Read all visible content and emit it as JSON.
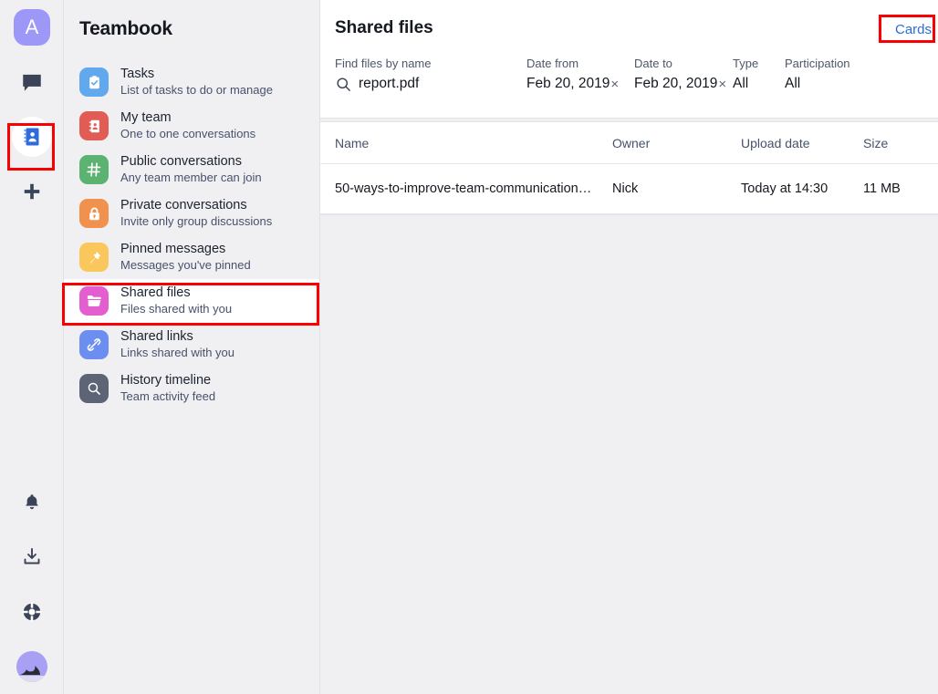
{
  "rail": {
    "workspace_avatar": {
      "name": "workspace-avatar",
      "initial": "A",
      "color": "#9d97f7"
    },
    "items": [
      {
        "name": "chat-icon",
        "label": "Chats",
        "active": false
      },
      {
        "name": "contacts-icon",
        "label": "Contacts",
        "active": true
      },
      {
        "name": "add-icon",
        "label": "Add",
        "active": false
      }
    ],
    "bottom_items": [
      {
        "name": "bell-icon",
        "label": "Notifications"
      },
      {
        "name": "download-icon",
        "label": "Downloads"
      },
      {
        "name": "lifebuoy-icon",
        "label": "Support"
      }
    ],
    "user_avatar": {
      "name": "user-avatar",
      "label": "User profile"
    }
  },
  "sidebar": {
    "title": "Teambook",
    "items": [
      {
        "label": "Tasks",
        "sub": "List of tasks to do or manage",
        "icon": "clipboard-check-icon",
        "color": "#62a8ec",
        "selected": false
      },
      {
        "label": "My team",
        "sub": "One to one conversations",
        "icon": "address-book-icon",
        "color": "#e05c54",
        "selected": false
      },
      {
        "label": "Public conversations",
        "sub": "Any team member can join",
        "icon": "hash-icon",
        "color": "#5cb270",
        "selected": false
      },
      {
        "label": "Private conversations",
        "sub": "Invite only group discussions",
        "icon": "lock-icon",
        "color": "#f0924d",
        "selected": false
      },
      {
        "label": "Pinned messages",
        "sub": "Messages you've pinned",
        "icon": "pin-icon",
        "color": "#f9c75b",
        "selected": false
      },
      {
        "label": "Shared files",
        "sub": "Files shared with you",
        "icon": "folder-icon",
        "color": "#e35fd0",
        "selected": true
      },
      {
        "label": "Shared links",
        "sub": "Links shared with you",
        "icon": "link-icon",
        "color": "#6b8ef0",
        "selected": false
      },
      {
        "label": "History timeline",
        "sub": "Team activity feed",
        "icon": "magnifier-icon",
        "color": "#5d6475",
        "selected": false
      }
    ]
  },
  "main": {
    "title": "Shared files",
    "view_toggle": {
      "label": "Cards",
      "color": "#2b6cdd"
    },
    "filters": [
      {
        "name": "find-files-by-name",
        "label": "Find files by name",
        "value": "report.pdf",
        "icon": "search-icon",
        "clearable": false
      },
      {
        "name": "date-from",
        "label": "Date from",
        "value": "Feb 20, 2019",
        "clear": "×",
        "clearable": true
      },
      {
        "name": "date-to",
        "label": "Date to",
        "value": "Feb 20, 2019",
        "clear": "×",
        "clearable": true
      },
      {
        "name": "type",
        "label": "Type",
        "value": "All",
        "clearable": false
      },
      {
        "name": "participation",
        "label": "Participation",
        "value": "All",
        "clearable": false
      }
    ],
    "table": {
      "columns": [
        "Name",
        "Owner",
        "Upload date",
        "Size"
      ],
      "rows": [
        {
          "name": "50-ways-to-improve-team-communication…",
          "owner": "Nick",
          "upload_date": "Today at 14:30",
          "size": "11 MB"
        }
      ]
    }
  },
  "annotations": {
    "highlight_color": "#fb0000",
    "boxes": [
      {
        "name": "highlight-contacts-rail-icon"
      },
      {
        "name": "highlight-shared-files-nav-item"
      },
      {
        "name": "highlight-cards-view-toggle"
      }
    ]
  }
}
